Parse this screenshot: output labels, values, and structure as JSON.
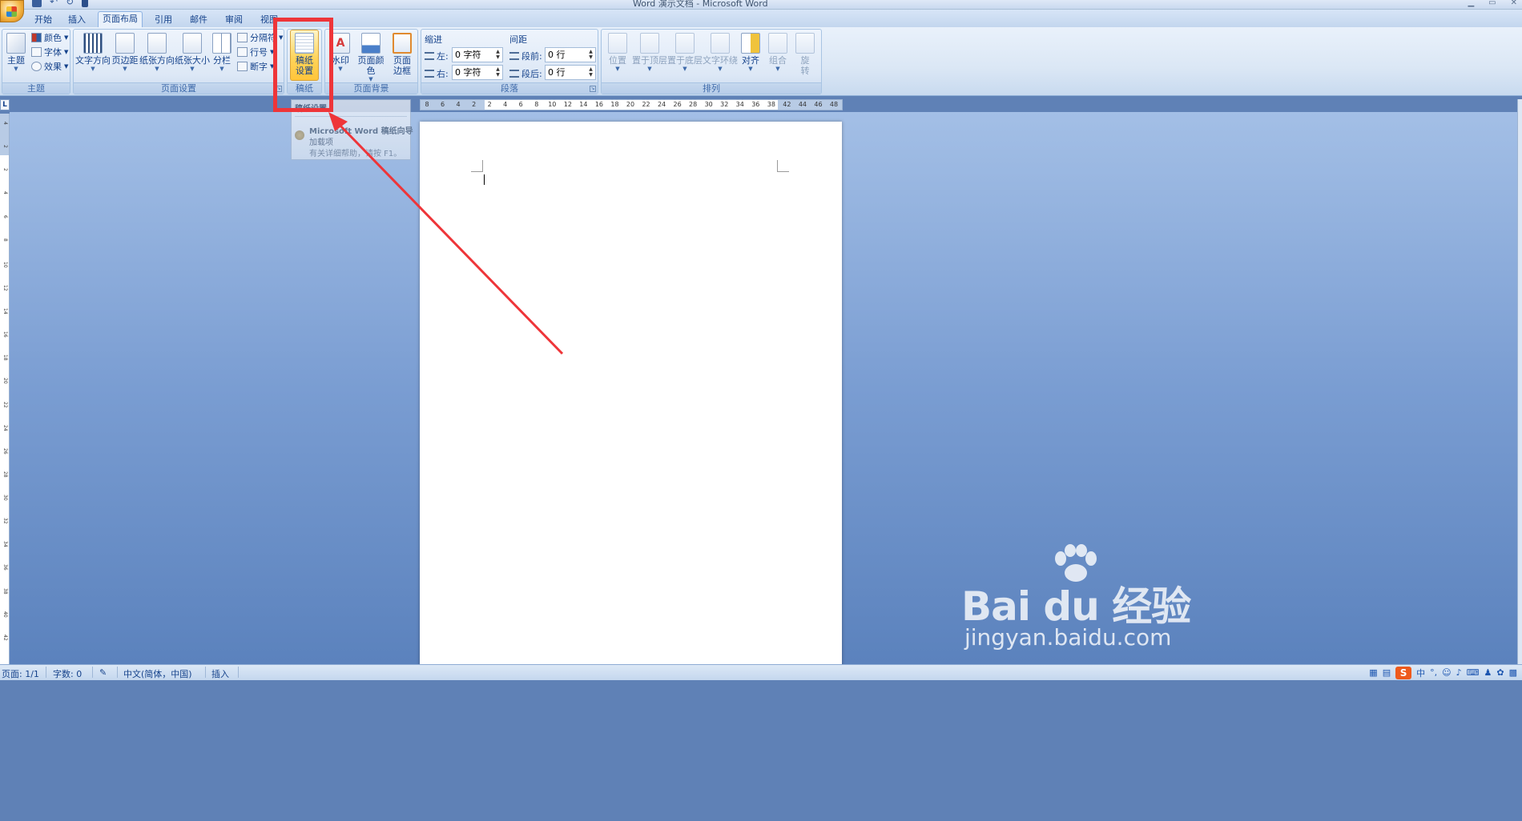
{
  "window": {
    "title": "Word 演示文档 - Microsoft Word"
  },
  "tabs": [
    {
      "label": "开始"
    },
    {
      "label": "插入"
    },
    {
      "label": "页面布局",
      "active": true
    },
    {
      "label": "引用"
    },
    {
      "label": "邮件"
    },
    {
      "label": "审阅"
    },
    {
      "label": "视图"
    }
  ],
  "ribbon": {
    "theme": {
      "label": "主题",
      "theme_button": "主题",
      "colors": "颜色",
      "fonts": "字体",
      "effects": "效果"
    },
    "page_setup": {
      "label": "页面设置",
      "text_direction": "文字方向",
      "margins": "页边距",
      "orientation": "纸张方向",
      "size": "纸张大小",
      "columns": "分栏",
      "breaks": "分隔符",
      "line_numbers": "行号",
      "hyphenation": "断字"
    },
    "gaozhi": {
      "label": "稿纸",
      "button_line1": "稿纸",
      "button_line2": "设置"
    },
    "page_background": {
      "label": "页面背景",
      "watermark": "水印",
      "page_color": "页面颜色",
      "page_border_line1": "页面",
      "page_border_line2": "边框"
    },
    "paragraph": {
      "label": "段落",
      "indent_title": "缩进",
      "spacing_title": "间距",
      "indent_left_label": "左:",
      "indent_left_value": "0 字符",
      "indent_right_label": "右:",
      "indent_right_value": "0 字符",
      "spacing_before_label": "段前:",
      "spacing_before_value": "0 行",
      "spacing_after_label": "段后:",
      "spacing_after_value": "0 行"
    },
    "arrange": {
      "label": "排列",
      "position": "位置",
      "bring_front": "置于顶层",
      "send_back": "置于底层",
      "text_wrap": "文字环绕",
      "align": "对齐",
      "group": "组合",
      "rotate_line1": "旋",
      "rotate_line2": "转"
    }
  },
  "tooltip": {
    "title": "稿纸设置",
    "line1": "Microsoft Word 稿纸向导",
    "line2": "加载项",
    "line3": "有关详细帮助，请按 F1。"
  },
  "ruler": {
    "corner": "L",
    "h_ticks": [
      "8",
      "6",
      "4",
      "2",
      "2",
      "4",
      "6",
      "8",
      "10",
      "12",
      "14",
      "16",
      "18",
      "20",
      "22",
      "24",
      "26",
      "28",
      "30",
      "32",
      "34",
      "36",
      "38",
      "42",
      "44",
      "46",
      "48"
    ],
    "v_ticks": [
      "4",
      "2",
      "2",
      "4",
      "6",
      "8",
      "10",
      "12",
      "14",
      "16",
      "18",
      "20",
      "22",
      "24",
      "26",
      "28",
      "30",
      "32",
      "34",
      "36",
      "38",
      "40",
      "42"
    ]
  },
  "statusbar": {
    "page": "页面: 1/1",
    "words": "字数: 0",
    "language": "中文(简体，中国)",
    "mode": "插入",
    "ime_logo": "S",
    "ime_lang": "中"
  },
  "watermark": {
    "brand": "Bai du 经验",
    "url": "jingyan.baidu.com"
  }
}
